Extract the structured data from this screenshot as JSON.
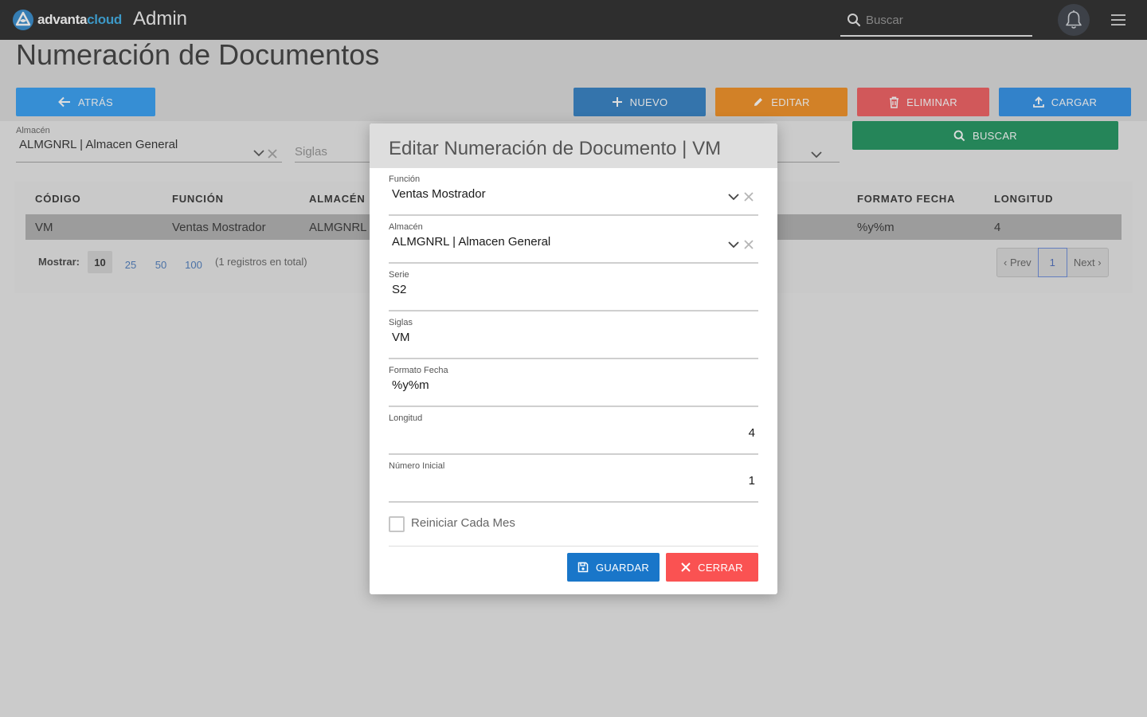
{
  "app": {
    "logo_prefix": "advanta",
    "logo_suffix": "cloud",
    "section": "Admin",
    "search_placeholder": "Buscar"
  },
  "page": {
    "title": "Numeración de Documentos"
  },
  "toolbar": {
    "back": "ATRÁS",
    "new": "NUEVO",
    "edit": "EDITAR",
    "delete": "ELIMINAR",
    "upload": "CARGAR",
    "search": "BUSCAR"
  },
  "filters": {
    "almacen_label": "Almacén",
    "almacen_value": "ALMGNRL | Almacen General",
    "siglas_placeholder": "Siglas"
  },
  "table": {
    "headers": {
      "codigo": "CÓDIGO",
      "funcion": "FUNCIÓN",
      "almacen": "ALMACÉN",
      "formato_fecha": "FORMATO FECHA",
      "longitud": "LONGITUD"
    },
    "rows": [
      {
        "codigo": "VM",
        "funcion": "Ventas Mostrador",
        "almacen": "ALMGNRL",
        "formato_fecha": "%y%m",
        "longitud": "4"
      }
    ],
    "show_label": "Mostrar:",
    "page_sizes": [
      "10",
      "25",
      "50",
      "100"
    ],
    "selected_page_size": "10",
    "total_text": "(1 registros en total)",
    "prev": "‹ Prev",
    "current_page": "1",
    "next": "Next ›"
  },
  "modal": {
    "title": "Editar Numeración de Documento | VM",
    "fields": {
      "funcion": {
        "label": "Función",
        "value": "Ventas Mostrador"
      },
      "almacen": {
        "label": "Almacén",
        "value": "ALMGNRL | Almacen General"
      },
      "serie": {
        "label": "Serie",
        "value": "S2"
      },
      "siglas": {
        "label": "Siglas",
        "value": "VM"
      },
      "formato_fecha": {
        "label": "Formato Fecha",
        "value": "%y%m"
      },
      "longitud": {
        "label": "Longitud",
        "value": "4"
      },
      "numero_inicial": {
        "label": "Número Inicial",
        "value": "1"
      }
    },
    "reset_monthly_label": "Reiniciar Cada Mes",
    "reset_monthly_checked": false,
    "save": "GUARDAR",
    "close": "CERRAR"
  },
  "colors": {
    "topbar": "#161616",
    "back": "#2196f3",
    "new": "#1e73be",
    "edit": "#f0850c",
    "delete": "#ef4e50",
    "upload": "#1b86e6",
    "search": "#0a8a4f",
    "save": "#1976c9",
    "close": "#fa5252"
  }
}
